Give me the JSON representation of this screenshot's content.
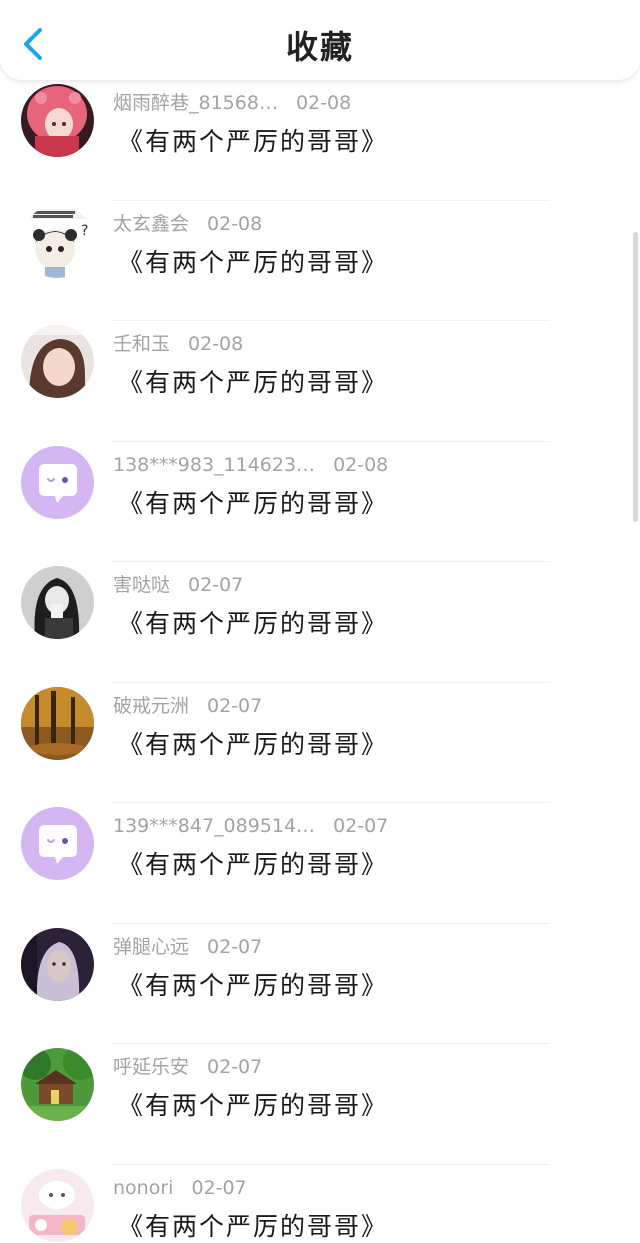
{
  "header": {
    "title": "收藏",
    "back_icon": "chevron-left-icon",
    "accent": "#1aa3f0"
  },
  "items": [
    {
      "user": "烟雨醉巷_81568…",
      "date": "02-08",
      "content": "《有两个严厉的哥哥》",
      "avatar": "anime-girl-pink-hair"
    },
    {
      "user": "太玄鑫会",
      "date": "02-08",
      "content": "《有两个严厉的哥哥》",
      "avatar": "panda-meme"
    },
    {
      "user": "壬和玉",
      "date": "02-08",
      "content": "《有两个严厉的哥哥》",
      "avatar": "girl-photo"
    },
    {
      "user": "138***983_114623…",
      "date": "02-08",
      "content": "《有两个严厉的哥哥》",
      "avatar": "default-chat"
    },
    {
      "user": "害哒哒",
      "date": "02-07",
      "content": "《有两个严厉的哥哥》",
      "avatar": "girl-bw"
    },
    {
      "user": "破戒元洲",
      "date": "02-07",
      "content": "《有两个严厉的哥哥》",
      "avatar": "autumn-forest"
    },
    {
      "user": "139***847_089514…",
      "date": "02-07",
      "content": "《有两个严厉的哥哥》",
      "avatar": "default-chat"
    },
    {
      "user": "弹腿心远",
      "date": "02-07",
      "content": "《有两个严厉的哥哥》",
      "avatar": "dark-portrait"
    },
    {
      "user": "呼延乐安",
      "date": "02-07",
      "content": "《有两个严厉的哥哥》",
      "avatar": "green-house"
    },
    {
      "user": "nonori",
      "date": "02-07",
      "content": "《有两个严厉的哥哥》",
      "avatar": "cartoon-room"
    }
  ]
}
